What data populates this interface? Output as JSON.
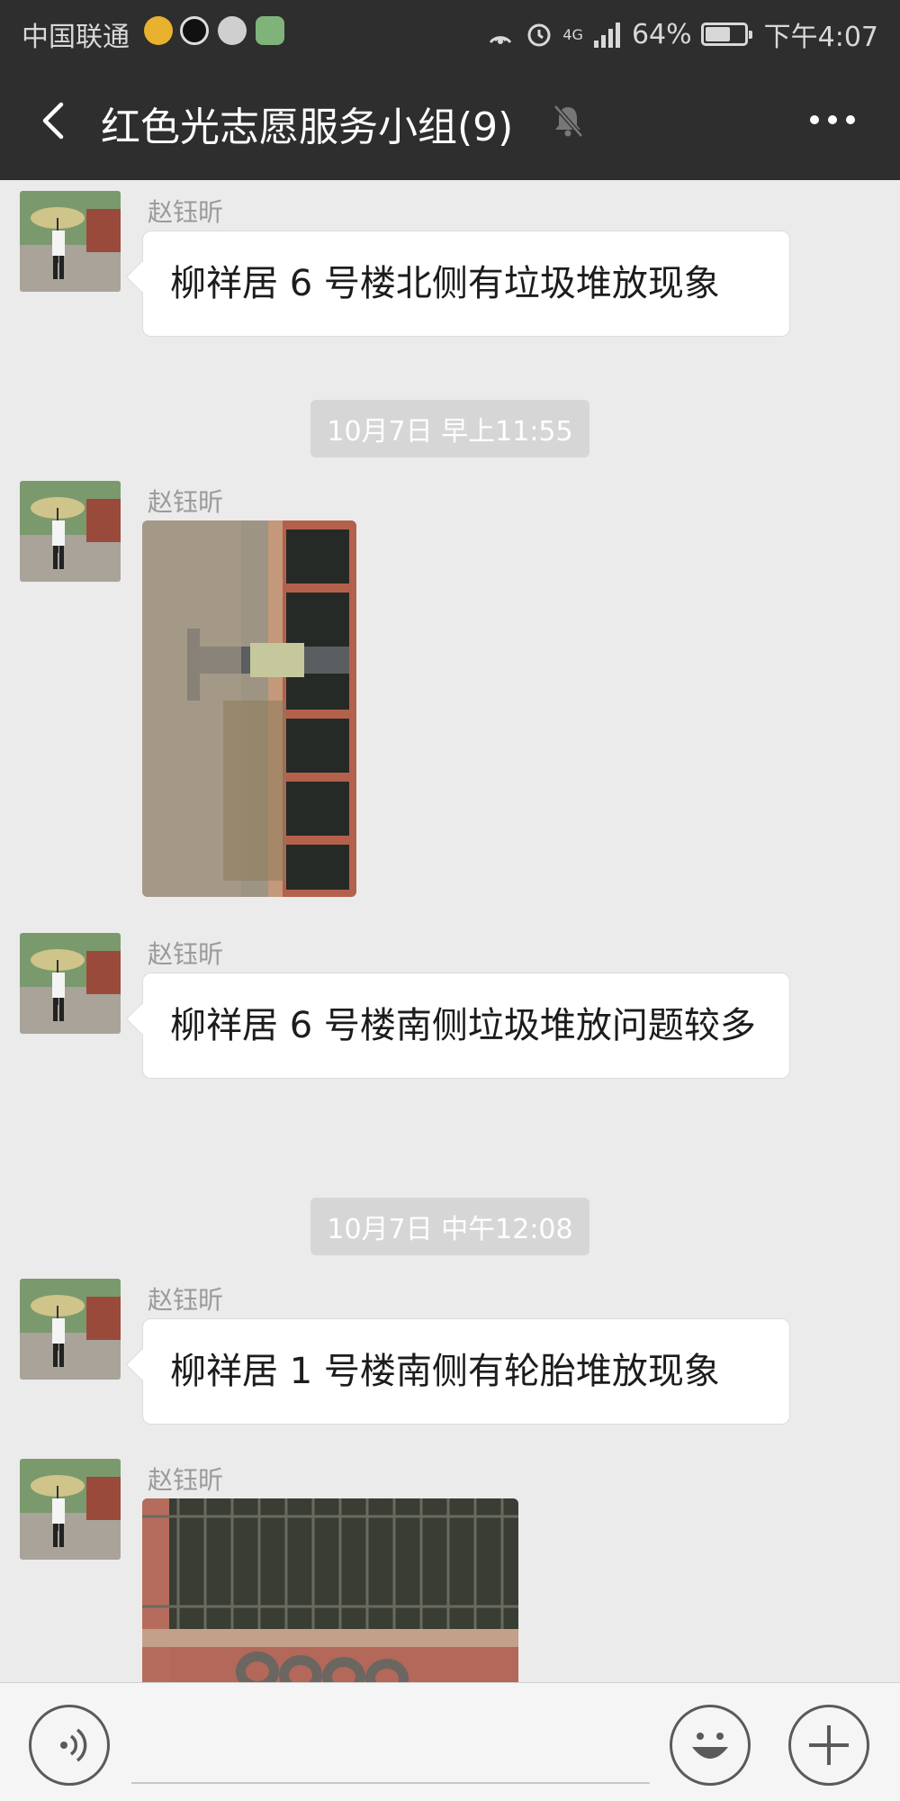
{
  "status_bar": {
    "carrier": "中国联通",
    "signal_label": "4G",
    "battery": "64%",
    "time": "下午4:07"
  },
  "header": {
    "title": "红色光志愿服务小组(9)",
    "back_icon": "chevron-left-icon",
    "mute_icon": "bell-off-icon",
    "more_icon": "more-dots-icon"
  },
  "messages": [
    {
      "sender": "赵钰昕",
      "text": "柳祥居 6 号楼北侧有垃圾堆放现象"
    },
    {
      "sender": "赵钰昕",
      "image": "photo-garbage-pile"
    },
    {
      "sender": "赵钰昕",
      "text": "柳祥居 6 号楼南侧垃圾堆放问题较多"
    },
    {
      "sender": "赵钰昕",
      "text": "柳祥居 1 号楼南侧有轮胎堆放现象"
    },
    {
      "sender": "赵钰昕",
      "image": "photo-tires-by-fence"
    }
  ],
  "timestamps": [
    "10月7日 早上11:55",
    "10月7日 中午12:08"
  ],
  "input_bar": {
    "voice_icon": "voice-icon",
    "emoji_icon": "emoji-icon",
    "plus_icon": "plus-icon",
    "message_value": ""
  }
}
